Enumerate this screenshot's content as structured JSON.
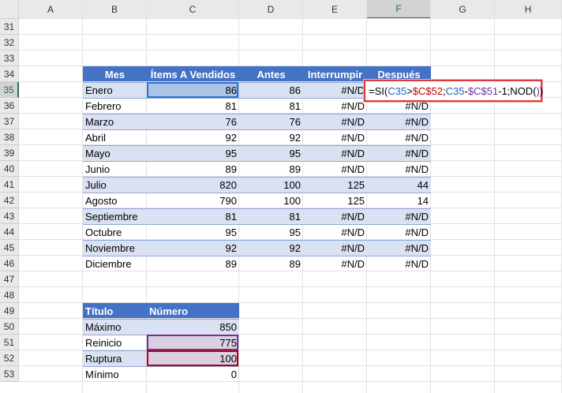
{
  "columns": [
    "A",
    "B",
    "C",
    "D",
    "E",
    "F",
    "G",
    "H"
  ],
  "selected_column": "F",
  "rows": [
    "31",
    "32",
    "33",
    "34",
    "35",
    "36",
    "37",
    "38",
    "39",
    "40",
    "41",
    "42",
    "43",
    "44",
    "45",
    "46",
    "47",
    "48",
    "49",
    "50",
    "51",
    "52",
    "53"
  ],
  "selected_row": "35",
  "table1": {
    "headers": [
      "Mes",
      "Ítems A Vendidos",
      "Antes",
      "Interrumpir",
      "Después"
    ],
    "rows": [
      [
        "Enero",
        "86",
        "86",
        "#N/D",
        ""
      ],
      [
        "Febrero",
        "81",
        "81",
        "#N/D",
        "#N/D"
      ],
      [
        "Marzo",
        "76",
        "76",
        "#N/D",
        "#N/D"
      ],
      [
        "Abril",
        "92",
        "92",
        "#N/D",
        "#N/D"
      ],
      [
        "Mayo",
        "95",
        "95",
        "#N/D",
        "#N/D"
      ],
      [
        "Junio",
        "89",
        "89",
        "#N/D",
        "#N/D"
      ],
      [
        "Julio",
        "820",
        "100",
        "125",
        "44"
      ],
      [
        "Agosto",
        "790",
        "100",
        "125",
        "14"
      ],
      [
        "Septiembre",
        "81",
        "81",
        "#N/D",
        "#N/D"
      ],
      [
        "Octubre",
        "95",
        "95",
        "#N/D",
        "#N/D"
      ],
      [
        "Noviembre",
        "92",
        "92",
        "#N/D",
        "#N/D"
      ],
      [
        "Diciembre",
        "89",
        "89",
        "#N/D",
        "#N/D"
      ]
    ]
  },
  "formula": {
    "p1": "=SI(",
    "p2": "C35",
    "p3": ">",
    "p4": "$C$52",
    "p5": ";",
    "p6": "C35",
    "p7": "-",
    "p8": "$C$51",
    "p9": "-1;NOD(",
    "p10": ")",
    "p11": ")"
  },
  "table2": {
    "headers": [
      "Título",
      "Número"
    ],
    "rows": [
      [
        "Máximo",
        "850"
      ],
      [
        "Reinicio",
        "775"
      ],
      [
        "Ruptura",
        "100"
      ],
      [
        "Mínimo",
        "0"
      ]
    ]
  },
  "colors": {
    "header_blue": "#4472c4",
    "band": "#d9e1f2",
    "formula_box": "#e0393e",
    "ref_blue": "#1f5fbf",
    "ref_red": "#c00000",
    "ref_purple": "#7030a0"
  }
}
